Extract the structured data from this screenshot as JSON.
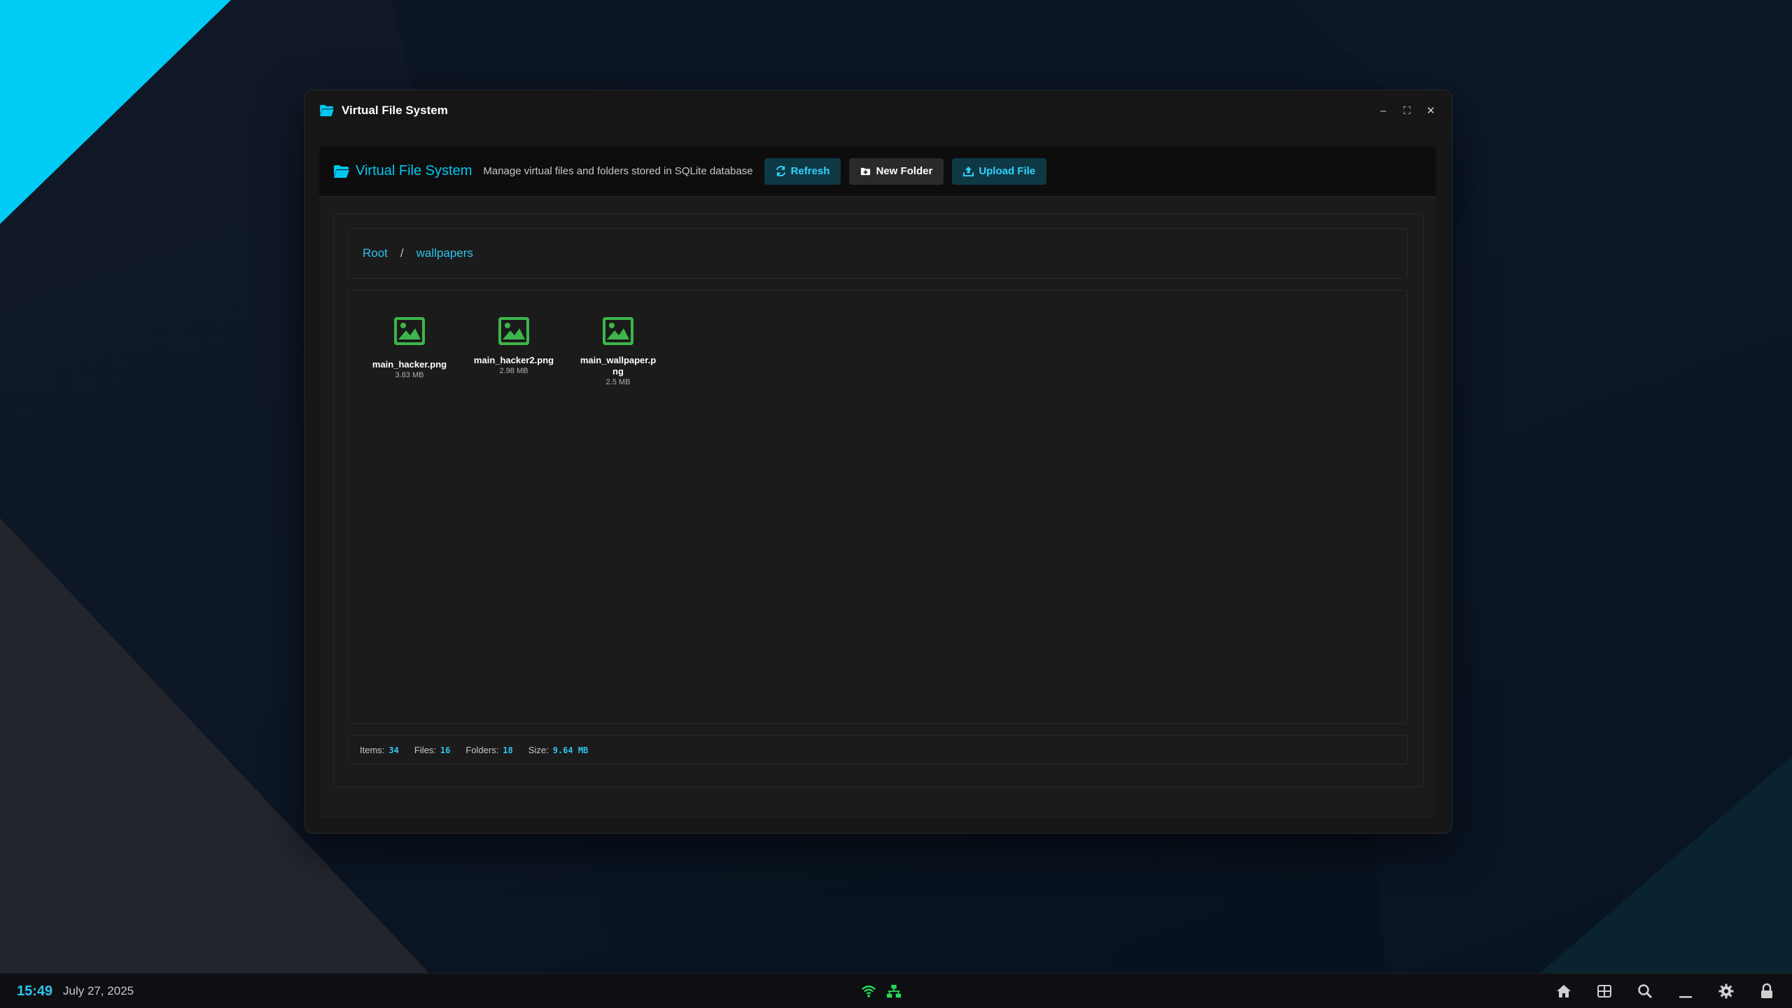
{
  "window": {
    "title": "Virtual File System",
    "controls": {
      "minimize": "–",
      "maximize": "⛶",
      "close": "✕"
    }
  },
  "header": {
    "title": "Virtual File System",
    "description": "Manage virtual files and folders stored in SQLite database",
    "buttons": {
      "refresh": "Refresh",
      "new_folder": "New Folder",
      "upload_file": "Upload File"
    }
  },
  "breadcrumb": {
    "items": [
      "Root",
      "wallpapers"
    ],
    "separator": "/"
  },
  "files": [
    {
      "name": "main_hacker.png",
      "size": "3.83 MB",
      "icon": "image-icon"
    },
    {
      "name": "main_hacker2.png",
      "size": "2.98 MB",
      "icon": "image-icon"
    },
    {
      "name": "main_wallpaper.png",
      "size": "2.5 MB",
      "icon": "image-icon"
    }
  ],
  "status": {
    "items_label": "Items:",
    "items_value": "34",
    "files_label": "Files:",
    "files_value": "16",
    "folders_label": "Folders:",
    "folders_value": "18",
    "size_label": "Size:",
    "size_value": "9.64 MB"
  },
  "taskbar": {
    "time": "15:49",
    "date": "July 27, 2025",
    "tray_icons": [
      "wifi-icon",
      "network-icon"
    ],
    "app_icons": [
      "home-icon",
      "grid-icon",
      "search-icon",
      "minimize-all-icon",
      "settings-icon",
      "lock-icon"
    ]
  },
  "colors": {
    "accent": "#00c8f0",
    "file_icon": "#3db54a",
    "tray_icon": "#22dd55",
    "desktop_accent": "#00ccf5"
  }
}
